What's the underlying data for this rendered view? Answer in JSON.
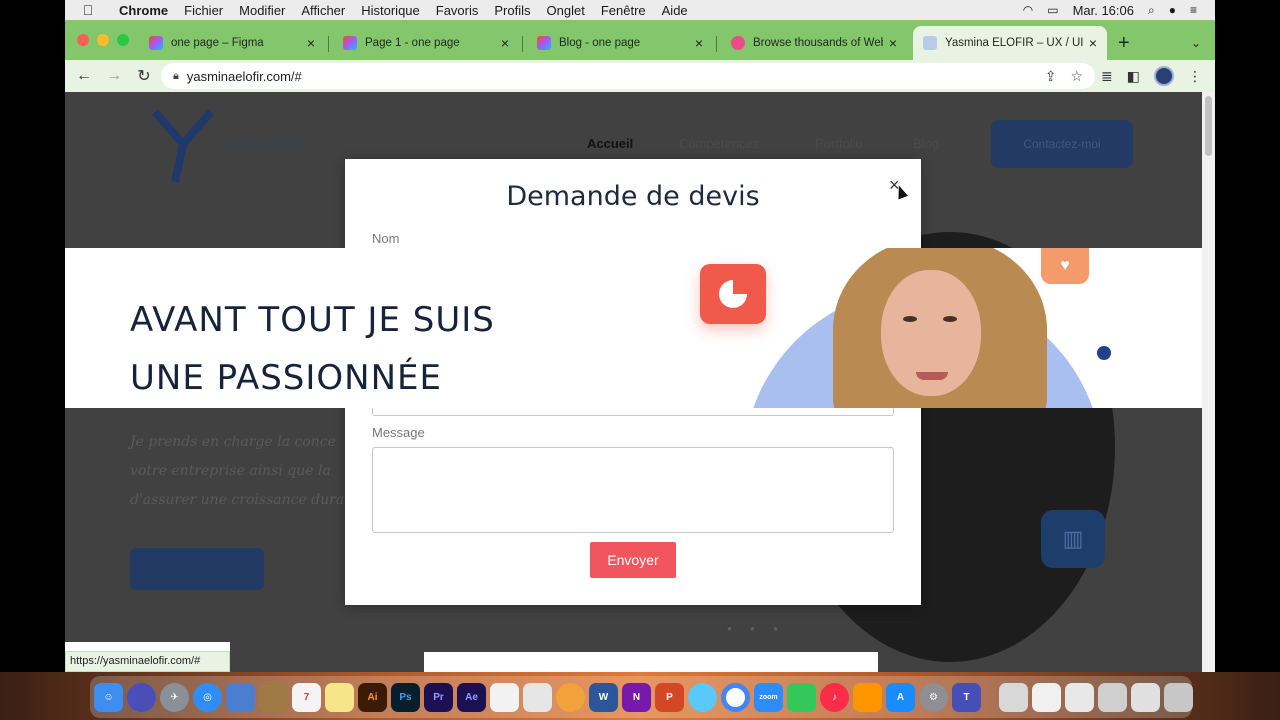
{
  "menubar": {
    "app_name": "Chrome",
    "items": [
      "Fichier",
      "Modifier",
      "Afficher",
      "Historique",
      "Favoris",
      "Profils",
      "Onglet",
      "Fenêtre",
      "Aide"
    ],
    "clock": "Mar. 16:06"
  },
  "tabs": [
    {
      "title": "one page – Figma"
    },
    {
      "title": "Page 1 - one page"
    },
    {
      "title": "Blog - one page"
    },
    {
      "title": "Browse thousands of Web"
    },
    {
      "title": "Yasmina ELOFIR – UX / UI"
    }
  ],
  "toolbar": {
    "url": "yasminaelofir.com/#"
  },
  "site": {
    "nav": [
      "Accueil",
      "Compétences",
      "Portfolio",
      "Blog"
    ],
    "cta": "Contactez-moi",
    "logo_text": "Yasmina Elofir",
    "hero_line1": "AVANT TOUT JE SUIS",
    "hero_line2": "UNE PASSIONNÉE",
    "body_line1": "Je prends en charge la conce",
    "body_line2": "votre entreprise ainsi que la",
    "body_line3": "d'assurer une croissance dura"
  },
  "modal": {
    "title": "Demande de devis",
    "name_label": "Nom",
    "message_label": "Message",
    "submit_label": "Envoyer",
    "close_symbol": "×"
  },
  "status_url": "https://yasminaelofir.com/#"
}
